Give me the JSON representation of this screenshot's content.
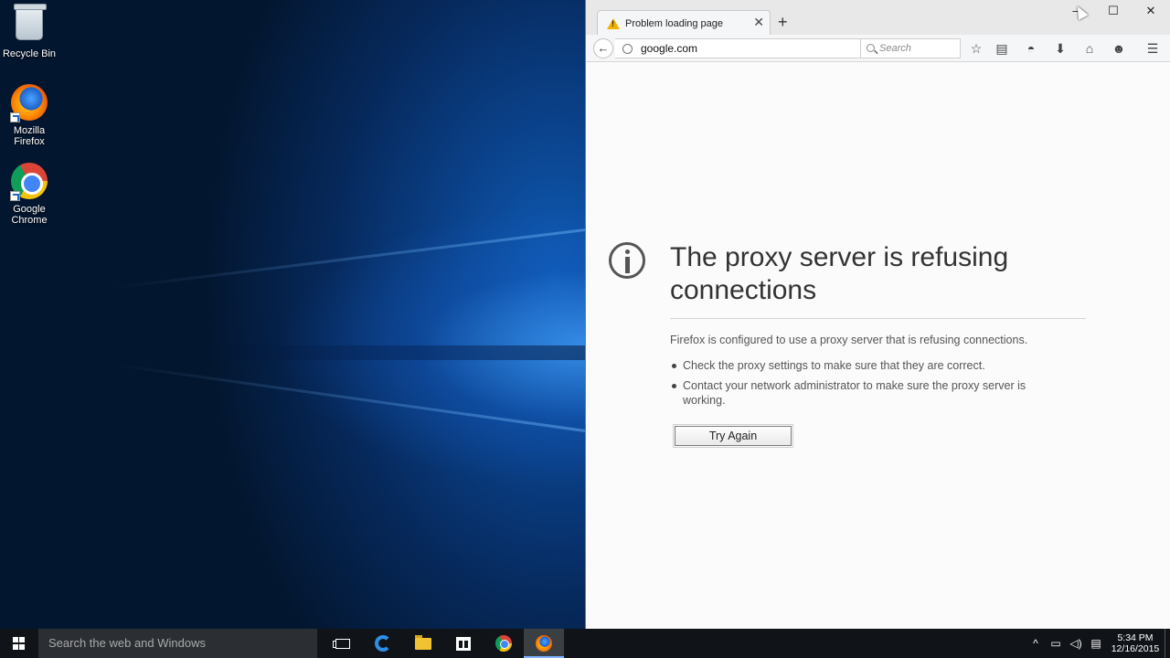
{
  "desktop": {
    "icons": [
      {
        "label": "Recycle Bin"
      },
      {
        "label": "Mozilla Firefox"
      },
      {
        "label": "Google Chrome"
      }
    ]
  },
  "browser": {
    "tab": {
      "title": "Problem loading page",
      "icon": "warning-icon"
    },
    "url": "google.com",
    "search_placeholder": "Search",
    "toolbar_icons": [
      "bookmark-star-icon",
      "reading-list-icon",
      "pocket-icon",
      "download-icon",
      "home-icon",
      "chat-icon",
      "menu-icon"
    ]
  },
  "error": {
    "title": "The proxy server is refusing connections",
    "description": "Firefox is configured to use a proxy server that is refusing connections.",
    "bullets": [
      "Check the proxy settings to make sure that they are correct.",
      "Contact your network administrator to make sure the proxy server is working."
    ],
    "button_label": "Try Again"
  },
  "taskbar": {
    "search_placeholder": "Search the web and Windows",
    "apps": [
      "task-view",
      "edge",
      "file-explorer",
      "store",
      "chrome",
      "firefox"
    ],
    "active_app": "firefox",
    "time": "5:34 PM",
    "date": "12/16/2015"
  }
}
